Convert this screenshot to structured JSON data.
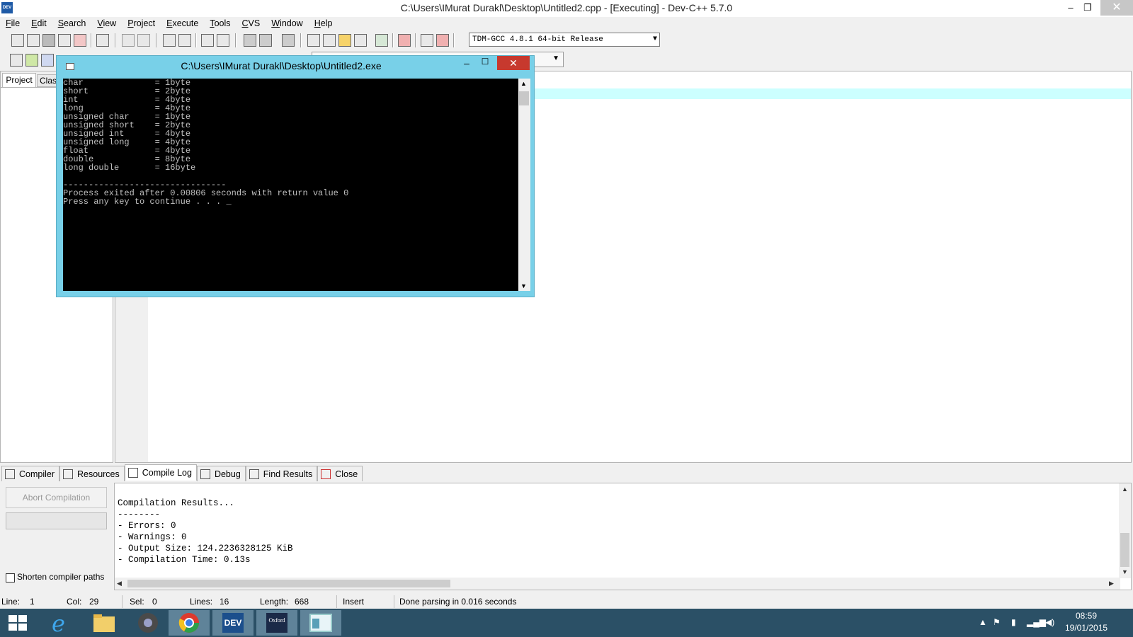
{
  "window": {
    "title": "C:\\Users\\IMurat Durakl\\Desktop\\Untitled2.cpp - [Executing] - Dev-C++ 5.7.0",
    "app_icon_text": "DEV",
    "minimize": "–",
    "maximize": "❐",
    "close": "✕"
  },
  "menu": {
    "items": [
      {
        "underline": "F",
        "rest": "ile"
      },
      {
        "underline": "E",
        "rest": "dit"
      },
      {
        "underline": "S",
        "rest": "earch"
      },
      {
        "underline": "V",
        "rest": "iew"
      },
      {
        "underline": "P",
        "rest": "roject"
      },
      {
        "underline": "E",
        "rest": "xecute"
      },
      {
        "underline": "T",
        "rest": "ools"
      },
      {
        "underline": "C",
        "rest": "VS"
      },
      {
        "underline": "W",
        "rest": "indow"
      },
      {
        "underline": "H",
        "rest": "elp"
      }
    ]
  },
  "toolbar": {
    "compiler": "TDM-GCC 4.8.1 64-bit Release",
    "dropdown_arrow": "▼"
  },
  "left_panel": {
    "tab_project": "Project",
    "tab_classes": "Clas"
  },
  "console": {
    "title": "C:\\Users\\IMurat Durakl\\Desktop\\Untitled2.exe",
    "minimize": "–",
    "maximize": "☐",
    "close": "✕",
    "lines": [
      "char              = 1byte",
      "short             = 2byte",
      "int               = 4byte",
      "long              = 4byte",
      "unsigned char     = 1byte",
      "unsigned short    = 2byte",
      "unsigned int      = 4byte",
      "unsigned long     = 4byte",
      "float             = 4byte",
      "double            = 8byte",
      "long double       = 16byte",
      "",
      "--------------------------------",
      "Process exited after 0.00806 seconds with return value 0",
      "Press any key to continue . . . _"
    ],
    "scroll_up": "▲",
    "scroll_down": "▼"
  },
  "bottom_tabs": [
    {
      "label": "Compiler",
      "active": false
    },
    {
      "label": "Resources",
      "active": false
    },
    {
      "label": "Compile Log",
      "active": true
    },
    {
      "label": "Debug",
      "active": false
    },
    {
      "label": "Find Results",
      "active": false
    },
    {
      "label": "Close",
      "active": false
    }
  ],
  "compile": {
    "abort_label": "Abort Compilation",
    "shorten_label": "Shorten compiler paths",
    "log_lines": [
      "Compilation Results...",
      "--------",
      "- Errors: 0",
      "- Warnings: 0",
      "- Output Size: 124.2236328125 KiB",
      "- Compilation Time: 0.13s"
    ],
    "arrow_up": "▲",
    "arrow_down": "▼",
    "arrow_left": "◀",
    "arrow_right": "▶"
  },
  "status": {
    "line_label": "Line:",
    "line_value": "1",
    "col_label": "Col:",
    "col_value": "29",
    "sel_label": "Sel:",
    "sel_value": "0",
    "lines_label": "Lines:",
    "lines_value": "16",
    "length_label": "Length:",
    "length_value": "668",
    "mode": "Insert",
    "message": "Done parsing in 0.016 seconds"
  },
  "taskbar": {
    "time": "08:59",
    "date": "19/01/2015",
    "dev_label": "DEV",
    "oxford_label": "Oxford"
  },
  "colors": {
    "console_frame": "#78d0e8",
    "current_line": "#ccffff",
    "taskbar": "#2b5066",
    "close_red": "#c7392e"
  }
}
